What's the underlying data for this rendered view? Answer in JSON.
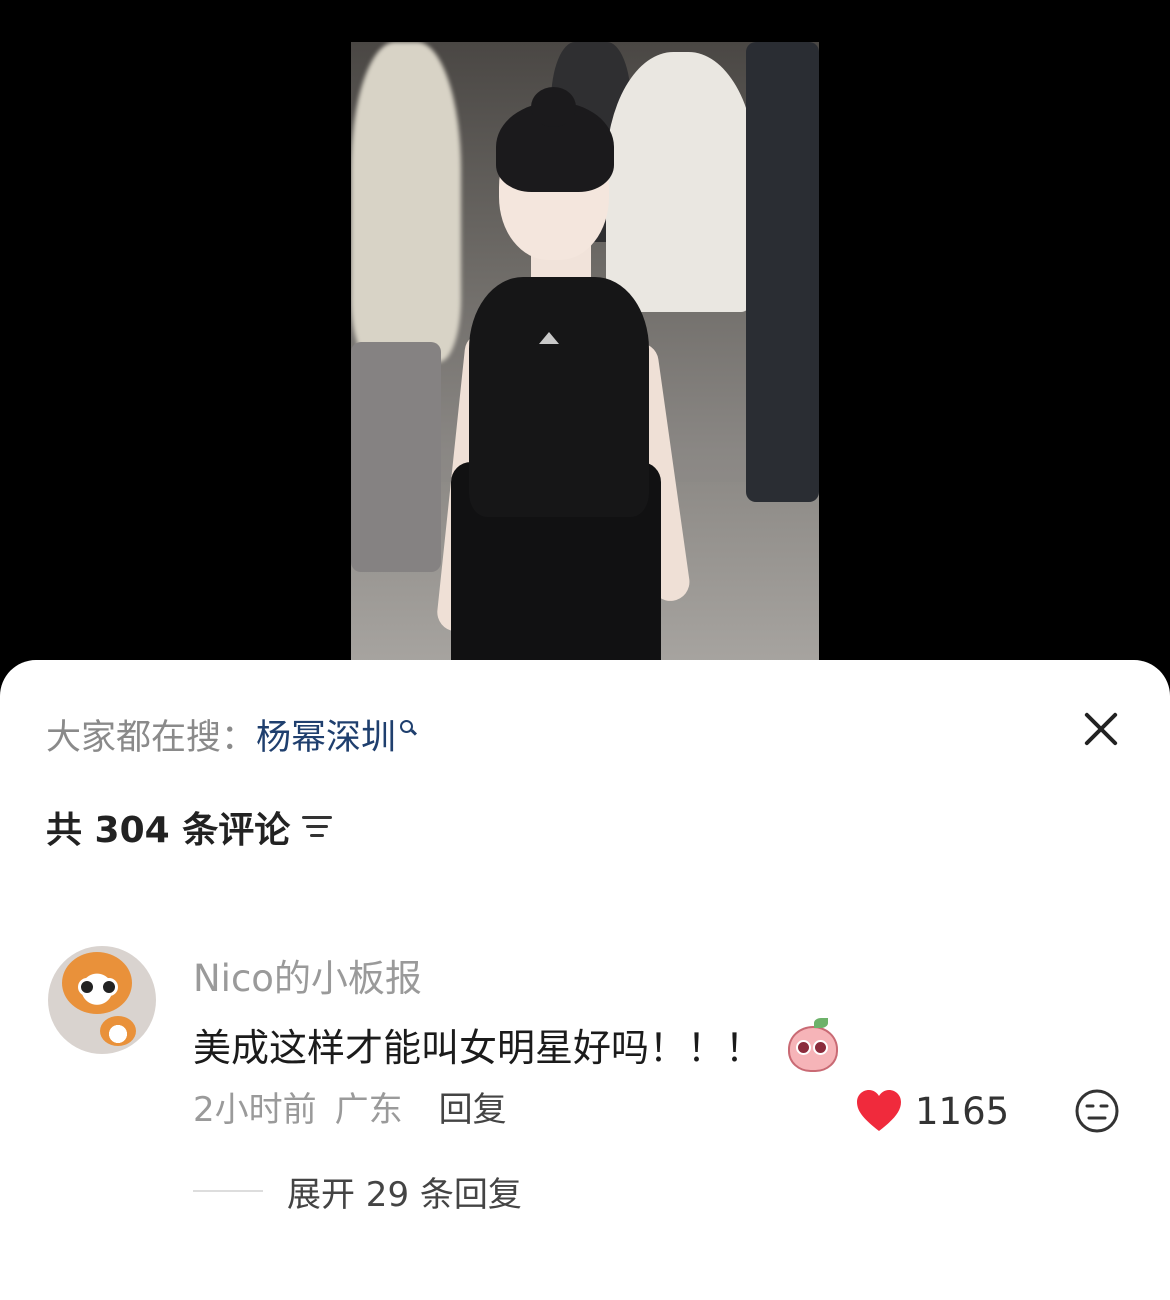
{
  "search_hint": {
    "prefix": "大家都在搜：",
    "keyword": "杨幂深圳"
  },
  "comments_header": {
    "count_text": "共 304 条评论"
  },
  "comment": {
    "username": "Nico的小板报",
    "text": "美成这样才能叫女明星好吗！！！",
    "time": "2小时前",
    "location": "广东",
    "reply_label": "回复",
    "like_count": "1165",
    "expand_text": "展开 29 条回复"
  },
  "colors": {
    "keyword": "#1f3f6e",
    "heart": "#f02a3c",
    "muted": "#9a9a9a"
  },
  "icons": {
    "close": "close-icon",
    "sort": "sort-filter-icon",
    "search": "search-icon",
    "like": "heart-icon",
    "dislike": "meh-face-icon"
  }
}
